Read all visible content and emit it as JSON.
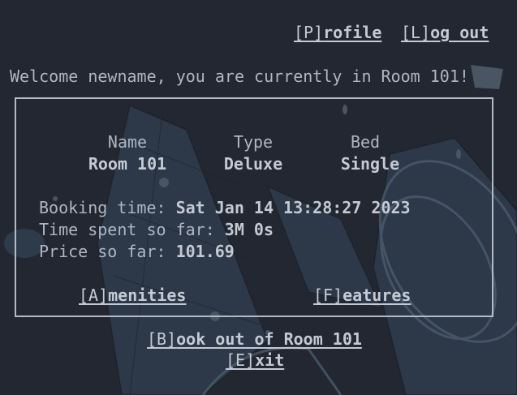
{
  "nav": {
    "profile": {
      "key": "[P]",
      "rest": "rofile"
    },
    "logout": {
      "key": "[L]",
      "rest": "og out"
    }
  },
  "welcome": "Welcome newname, you are currently in Room 101!",
  "room": {
    "headers": {
      "name": "Name",
      "type": "Type",
      "bed": "Bed"
    },
    "values": {
      "name": "Room 101",
      "type": "Deluxe",
      "bed": "Single"
    }
  },
  "booking": {
    "time_label": "Booking time: ",
    "time_value": "Sat Jan 14 13:28:27 2023",
    "spent_label": "Time spent so far: ",
    "spent_value": "3M 0s",
    "price_label": "Price so far: ",
    "price_value": "101.69"
  },
  "actions": {
    "amenities": {
      "key": "[A]",
      "rest": "menities"
    },
    "features": {
      "key": "[F]",
      "rest": "eatures"
    },
    "bookout": {
      "key": "[B]",
      "rest": "ook out of Room 101"
    },
    "exit": {
      "key": "[E]",
      "rest": "xit"
    }
  }
}
